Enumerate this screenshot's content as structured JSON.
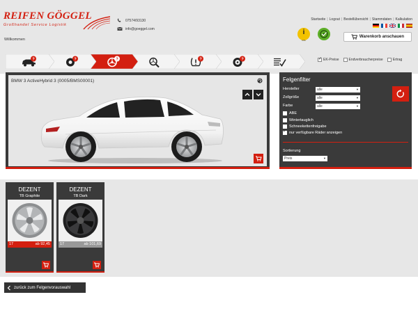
{
  "brand": {
    "name": "REIFEN GÖGGEL",
    "tagline": "Großhandel Service Logistik",
    "welcome": "Willkommen"
  },
  "contact": {
    "phone": "07574/93130",
    "email": "info@goeggel.com"
  },
  "topnav": [
    "Startseite",
    "Logout",
    "Bestellübersicht",
    "Stammdaten",
    "Kalkulation"
  ],
  "flags": [
    "de",
    "fr",
    "gb",
    "it",
    "es"
  ],
  "header_buttons": {
    "info_label": "Info",
    "cart_label": "Warenkorb anschauen"
  },
  "steps": [
    {
      "icon": "car-question-icon",
      "active": false
    },
    {
      "icon": "tire-question-icon",
      "active": false
    },
    {
      "icon": "rim-question-icon",
      "active": true
    },
    {
      "icon": "rim-search-icon",
      "active": false
    },
    {
      "icon": "tpms-question-icon",
      "active": false
    },
    {
      "icon": "tire-rim-question-icon",
      "active": false
    },
    {
      "icon": "checklist-icon",
      "active": false
    }
  ],
  "options": [
    {
      "label": "EK-Preise",
      "checked": true
    },
    {
      "label": "Endverbraucherpreise",
      "checked": false
    },
    {
      "label": "Ertrag",
      "checked": false
    }
  ],
  "vehicle": {
    "title": "BMW 3 ActiveHybrid 3 (0005/BMS00001)"
  },
  "filter": {
    "title": "Felgenfilter",
    "fields": [
      {
        "label": "Hersteller",
        "value": "alle"
      },
      {
        "label": "Zollgröße",
        "value": "alle"
      },
      {
        "label": "Farbe",
        "value": "alle"
      }
    ],
    "checks": [
      {
        "label": "ABE",
        "checked": false
      },
      {
        "label": "Wintertauglich",
        "checked": false
      },
      {
        "label": "Schneekettenfreigabe",
        "checked": false
      },
      {
        "label": "nur verfügbare Räder anzeigen",
        "checked": true
      }
    ],
    "sort_label": "Sortierung",
    "sort_value": "Preis"
  },
  "wheels": [
    {
      "brand": "DEZENT",
      "model": "TB Graphite",
      "size": "17",
      "price": "ab 92,45",
      "highlight": true,
      "color": "#9a9c9e"
    },
    {
      "brand": "DEZENT",
      "model": "TB Dark",
      "size": "17",
      "price": "ab 101,69",
      "highlight": false,
      "color": "#2e2e30"
    }
  ],
  "back_label": "zurück zum Felgenvorauswahl",
  "colors": {
    "accent": "#d31f10",
    "panel": "#3a3a3a",
    "background": "#e7e7e7"
  }
}
